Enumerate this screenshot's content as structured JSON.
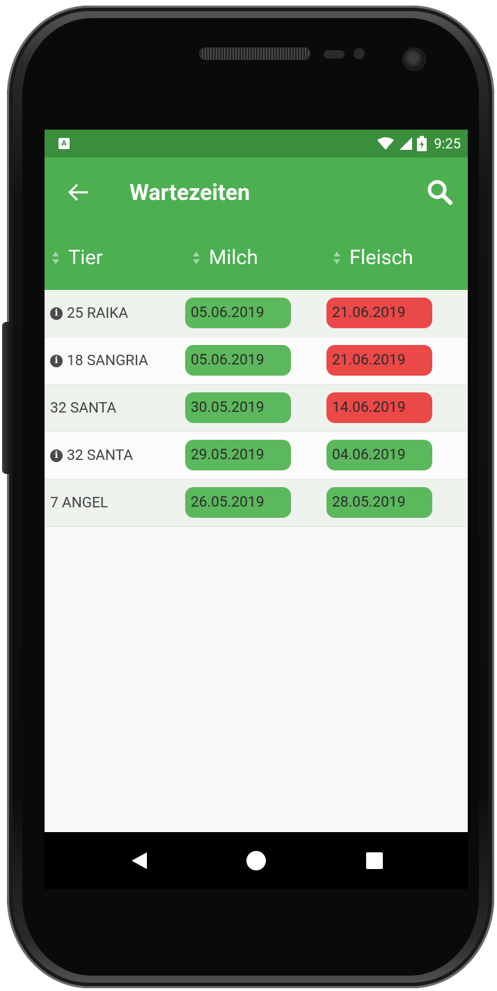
{
  "status_bar": {
    "time": "9:25",
    "notification_icon_letter": "A"
  },
  "app_bar": {
    "title": "Wartezeiten",
    "back_icon": "arrow-left-icon",
    "search_icon": "magnifier-icon"
  },
  "table": {
    "columns": [
      {
        "label": "Tier"
      },
      {
        "label": "Milch"
      },
      {
        "label": "Fleisch"
      }
    ],
    "rows": [
      {
        "animal": "25 RAIKA",
        "has_info": true,
        "milch": "05.06.2019",
        "milch_status": "ok",
        "fleisch": "21.06.2019",
        "fleisch_status": "pending"
      },
      {
        "animal": "18 SANGRIA",
        "has_info": true,
        "milch": "05.06.2019",
        "milch_status": "ok",
        "fleisch": "21.06.2019",
        "fleisch_status": "pending"
      },
      {
        "animal": "32 SANTA",
        "has_info": false,
        "milch": "30.05.2019",
        "milch_status": "ok",
        "fleisch": "14.06.2019",
        "fleisch_status": "pending"
      },
      {
        "animal": "32 SANTA",
        "has_info": true,
        "milch": "29.05.2019",
        "milch_status": "ok",
        "fleisch": "04.06.2019",
        "fleisch_status": "ok"
      },
      {
        "animal": "7 ANGEL",
        "has_info": false,
        "milch": "26.05.2019",
        "milch_status": "ok",
        "fleisch": "28.05.2019",
        "fleisch_status": "ok"
      }
    ]
  },
  "colors": {
    "app_bar": "#4caf50",
    "status_bar": "#3a8f3d",
    "ok_pill": "#5cb85c",
    "pending_pill": "#eb4848"
  },
  "nav_bar": {
    "icons": [
      "triangle-back-icon",
      "circle-home-icon",
      "square-recents-icon"
    ]
  }
}
